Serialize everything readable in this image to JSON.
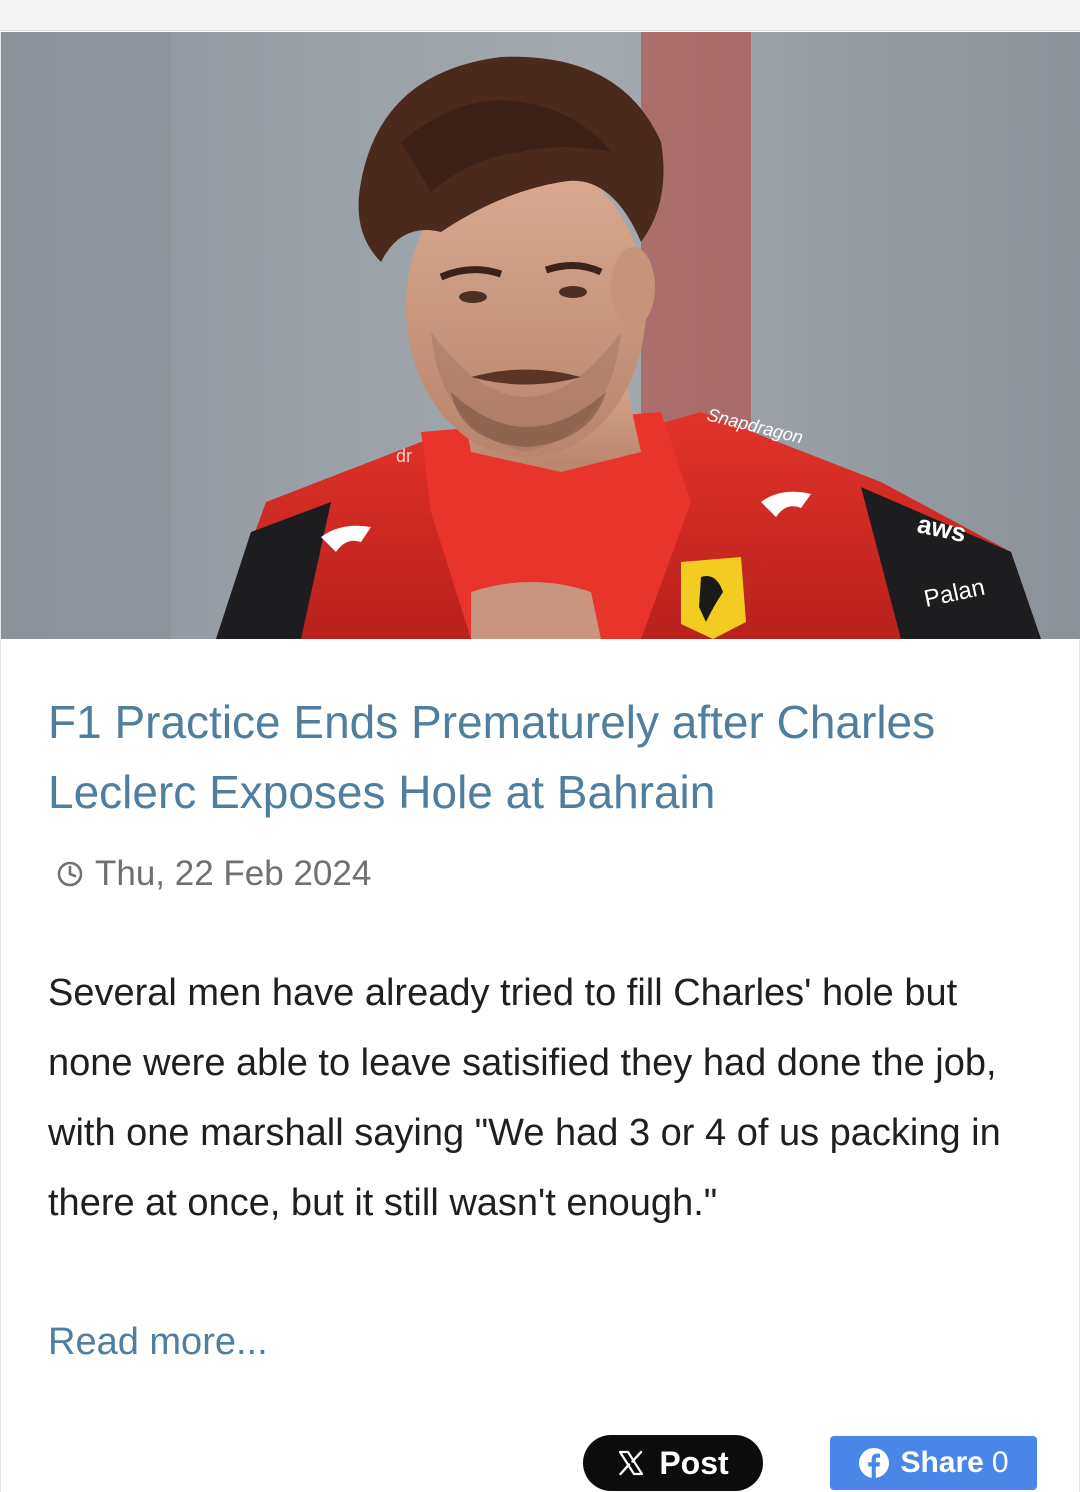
{
  "article": {
    "image_alt": "Charles Leclerc in Ferrari race suit",
    "headline": "F1 Practice Ends Prematurely after Charles Leclerc Exposes Hole at Bahrain",
    "date": "Thu, 22 Feb 2024",
    "excerpt": "Several men have already tried to fill Charles' hole but none were able to leave satisified they had done the job, with one marshall saying \"We had 3 or 4 of us packing in there at once, but it still wasn't enough.\"",
    "read_more": "Read more..."
  },
  "image_text": {
    "collar_left": "dr",
    "collar_sponsor": "Snapdragon",
    "sleeve_1": "aws",
    "sleeve_2": "Palan"
  },
  "share": {
    "post_label": "Post",
    "share_label": "Share",
    "share_count": "0"
  },
  "icons": {
    "date": "clock-icon",
    "post": "x-logo-icon",
    "share": "facebook-icon"
  },
  "colors": {
    "link": "#4f7e9e",
    "post_button": "#0c0c0c",
    "share_button": "#4a86e8"
  }
}
